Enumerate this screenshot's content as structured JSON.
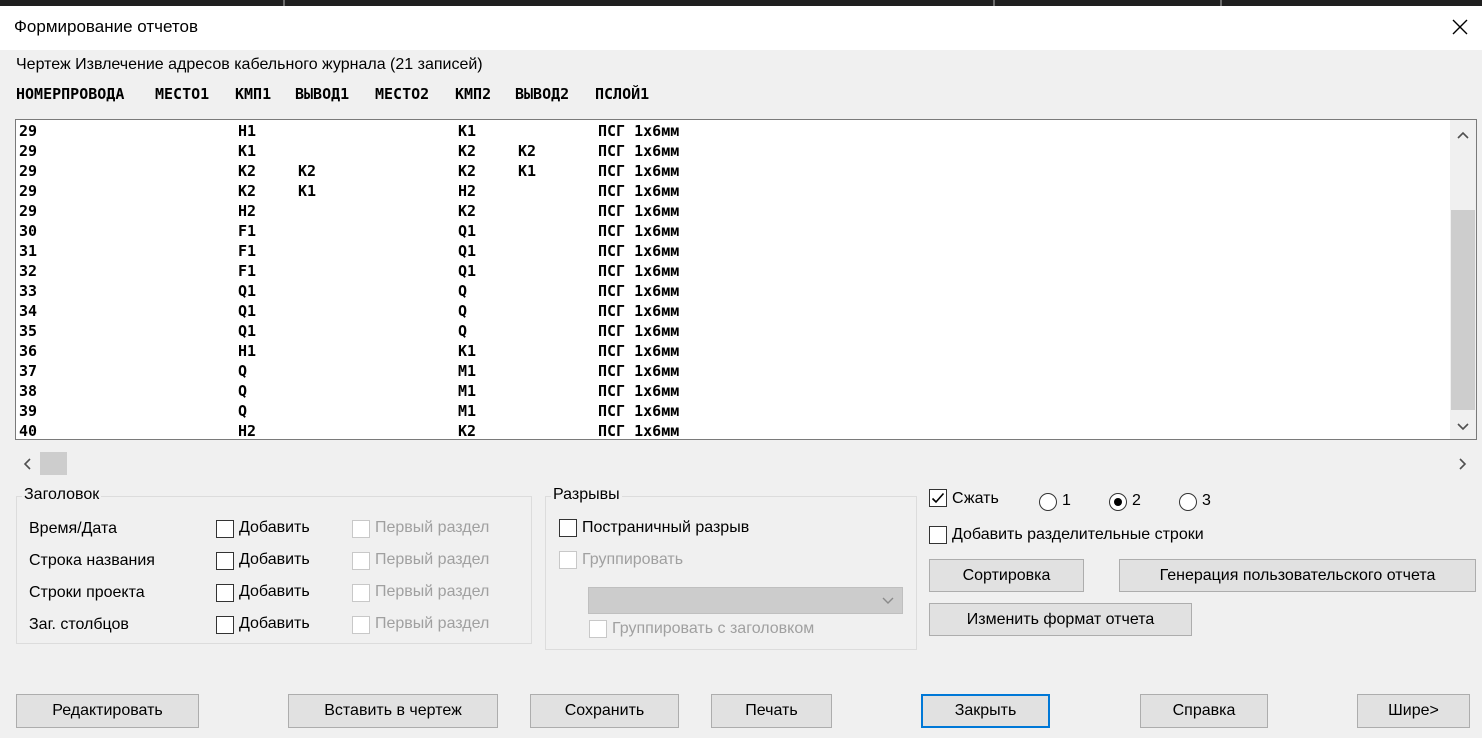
{
  "window": {
    "title": "Формирование отчетов",
    "close_icon": "close-icon"
  },
  "report": {
    "caption": "Чертеж Извлечение адресов кабельного журнала (21 записей)",
    "columns": [
      "НОМЕРПРОВОДА",
      "МЕСТО1",
      "КМП1",
      "ВЫВОД1",
      "МЕСТО2",
      "КМП2",
      "ВЫВОД2",
      "ПСЛОЙ1"
    ],
    "rows": [
      [
        "29",
        "",
        "H1",
        "",
        "",
        "K1",
        "",
        "ПСГ 1х6мм"
      ],
      [
        "29",
        "",
        "K1",
        "",
        "",
        "K2",
        "K2",
        "ПСГ 1х6мм"
      ],
      [
        "29",
        "",
        "K2",
        "K2",
        "",
        "K2",
        "K1",
        "ПСГ 1х6мм"
      ],
      [
        "29",
        "",
        "K2",
        "K1",
        "",
        "H2",
        "",
        "ПСГ 1х6мм"
      ],
      [
        "29",
        "",
        "H2",
        "",
        "",
        "K2",
        "",
        "ПСГ 1х6мм"
      ],
      [
        "30",
        "",
        "F1",
        "",
        "",
        "Q1",
        "",
        "ПСГ 1х6мм"
      ],
      [
        "31",
        "",
        "F1",
        "",
        "",
        "Q1",
        "",
        "ПСГ 1х6мм"
      ],
      [
        "32",
        "",
        "F1",
        "",
        "",
        "Q1",
        "",
        "ПСГ 1х6мм"
      ],
      [
        "33",
        "",
        "Q1",
        "",
        "",
        "Q",
        "",
        "ПСГ 1х6мм"
      ],
      [
        "34",
        "",
        "Q1",
        "",
        "",
        "Q",
        "",
        "ПСГ 1х6мм"
      ],
      [
        "35",
        "",
        "Q1",
        "",
        "",
        "Q",
        "",
        "ПСГ 1х6мм"
      ],
      [
        "36",
        "",
        "H1",
        "",
        "",
        "K1",
        "",
        "ПСГ 1х6мм"
      ],
      [
        "37",
        "",
        "Q",
        "",
        "",
        "M1",
        "",
        "ПСГ 1х6мм"
      ],
      [
        "38",
        "",
        "Q",
        "",
        "",
        "M1",
        "",
        "ПСГ 1х6мм"
      ],
      [
        "39",
        "",
        "Q",
        "",
        "",
        "M1",
        "",
        "ПСГ 1х6мм"
      ],
      [
        "40",
        "",
        "H2",
        "",
        "",
        "K2",
        "",
        "ПСГ 1х6мм"
      ]
    ]
  },
  "header_group": {
    "title": "Заголовок",
    "rows": [
      {
        "label": "Время/Дата",
        "add": "Добавить",
        "first": "Первый раздел"
      },
      {
        "label": "Строка названия",
        "add": "Добавить",
        "first": "Первый раздел"
      },
      {
        "label": "Строки проекта",
        "add": "Добавить",
        "first": "Первый раздел"
      },
      {
        "label": "Заг. столбцов",
        "add": "Добавить",
        "first": "Первый раздел"
      }
    ]
  },
  "breaks_group": {
    "title": "Разрывы",
    "page_break": "Постраничный разрыв",
    "group": "Группировать",
    "group_with_header": "Группировать с заголовком"
  },
  "options": {
    "compress": "Сжать",
    "compress_checked": true,
    "radio": [
      "1",
      "2",
      "3"
    ],
    "radio_selected": "2",
    "separator_rows": "Добавить разделительные строки"
  },
  "buttons": {
    "sort": "Сортировка",
    "custom_report": "Генерация пользовательского отчета",
    "change_format": "Изменить формат отчета",
    "edit": "Редактировать",
    "insert": "Вставить в чертеж",
    "save": "Сохранить",
    "print": "Печать",
    "close": "Закрыть",
    "help": "Справка",
    "wider": "Шире>"
  }
}
